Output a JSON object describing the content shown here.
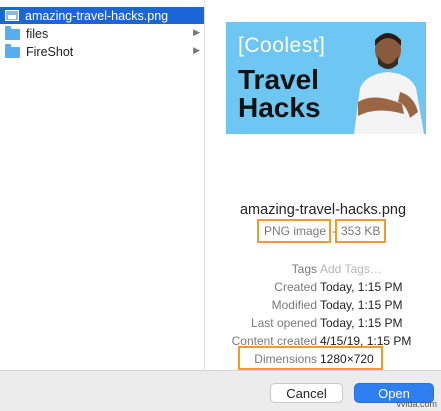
{
  "sidebar": {
    "items": [
      {
        "label": "amazing-travel-hacks.png",
        "icon": "image-file-icon",
        "selected": true
      },
      {
        "label": "files",
        "icon": "folder-icon",
        "has_children": true
      },
      {
        "label": "FireShot",
        "icon": "folder-icon",
        "has_children": true
      }
    ],
    "chevron": "▶"
  },
  "preview": {
    "thumbnail": {
      "bracket_open": "[",
      "coolest": "Coolest",
      "bracket_close": "]",
      "line1": "Travel",
      "line2": "Hacks"
    },
    "filename": "amazing-travel-hacks.png",
    "kind": "PNG image",
    "separator": "-",
    "size": "353 KB"
  },
  "metadata": [
    {
      "label": "Tags",
      "value": "Add Tags…",
      "placeholder": true
    },
    {
      "label": "Created",
      "value": "Today, 1:15 PM"
    },
    {
      "label": "Modified",
      "value": "Today, 1:15 PM"
    },
    {
      "label": "Last opened",
      "value": "Today, 1:15 PM"
    },
    {
      "label": "Content created",
      "value": "4/15/19, 1:15 PM"
    },
    {
      "label": "Dimensions",
      "value": "1280×720"
    }
  ],
  "footer": {
    "cancel_label": "Cancel",
    "open_label": "Open"
  },
  "watermark": "vvida.com",
  "colors": {
    "selection": "#1a65d8",
    "highlight_box": "#f29a2e",
    "open_button": "#2d7ff2",
    "thumbnail_bg": "#6ec6f3"
  }
}
